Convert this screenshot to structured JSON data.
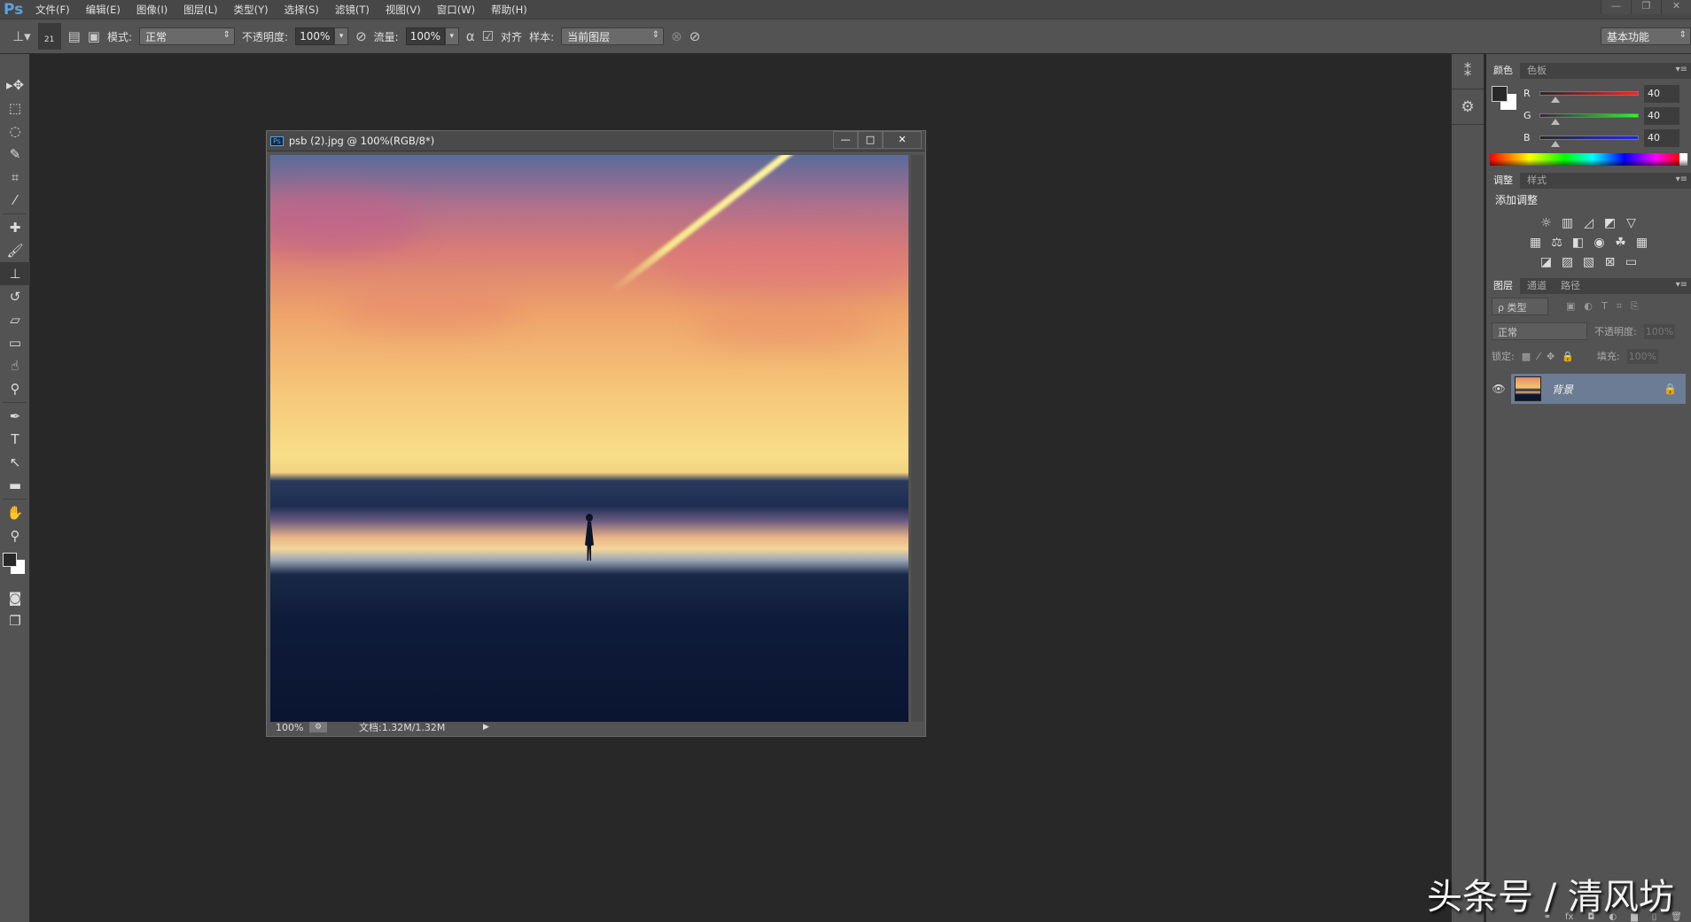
{
  "app": {
    "logo": "Ps"
  },
  "menu": [
    "文件(F)",
    "编辑(E)",
    "图像(I)",
    "图层(L)",
    "类型(Y)",
    "选择(S)",
    "滤镜(T)",
    "视图(V)",
    "窗口(W)",
    "帮助(H)"
  ],
  "window_controls": {
    "minimize": "—",
    "restore": "❐",
    "close": "✕"
  },
  "options": {
    "brush_size": "21",
    "mode_label": "模式:",
    "mode_value": "正常",
    "opacity_label": "不透明度:",
    "opacity_value": "100%",
    "flow_label": "流量:",
    "flow_value": "100%",
    "aligned_label": "对齐",
    "aligned_checked": true,
    "sample_label": "样本:",
    "sample_value": "当前图层",
    "workspace": "基本功能"
  },
  "tools": [
    {
      "icon": "move-icon",
      "g": "▸✥"
    },
    {
      "icon": "marquee-icon",
      "g": "⬚"
    },
    {
      "icon": "lasso-icon",
      "g": "◌"
    },
    {
      "icon": "quick-select-icon",
      "g": "✎"
    },
    {
      "icon": "crop-icon",
      "g": "⌗"
    },
    {
      "icon": "eyedropper-icon",
      "g": "⁄"
    },
    {
      "icon": "healing-brush-icon",
      "g": "✚"
    },
    {
      "icon": "brush-icon",
      "g": "🖌"
    },
    {
      "icon": "clone-stamp-icon",
      "g": "⊥",
      "active": true
    },
    {
      "icon": "history-brush-icon",
      "g": "↺"
    },
    {
      "icon": "eraser-icon",
      "g": "▱"
    },
    {
      "icon": "gradient-icon",
      "g": "▭"
    },
    {
      "icon": "blur-icon",
      "g": "☝"
    },
    {
      "icon": "dodge-icon",
      "g": "⚲"
    },
    {
      "icon": "pen-icon",
      "g": "✒"
    },
    {
      "icon": "type-icon",
      "g": "T"
    },
    {
      "icon": "path-select-icon",
      "g": "↖"
    },
    {
      "icon": "rectangle-icon",
      "g": "▬"
    },
    {
      "icon": "hand-icon",
      "g": "✋"
    },
    {
      "icon": "zoom-icon",
      "g": "⚲"
    }
  ],
  "colors": {
    "foreground": "#282828",
    "background": "#ffffff",
    "accent": "#6b7c94"
  },
  "document": {
    "title": "psb (2).jpg @ 100%(RGB/8*)",
    "zoom": "100%",
    "doc_size": "文档:1.32M/1.32M"
  },
  "panels": {
    "color": {
      "tabs": [
        "颜色",
        "色板"
      ],
      "r": {
        "label": "R",
        "value": "40"
      },
      "g": {
        "label": "G",
        "value": "40"
      },
      "b": {
        "label": "B",
        "value": "40"
      }
    },
    "adjustments": {
      "tabs": [
        "调整",
        "样式"
      ],
      "heading": "添加调整"
    },
    "layers": {
      "tabs": [
        "图层",
        "通道",
        "路径"
      ],
      "filter": "ρ 类型",
      "blend": "正常",
      "opacity_label": "不透明度:",
      "opacity_value": "100%",
      "lock_label": "锁定:",
      "fill_label": "填充:",
      "fill_value": "100%",
      "items": [
        {
          "name": "背景",
          "visible": true,
          "locked": true
        }
      ]
    }
  },
  "watermark": "头条号 / 清风坊"
}
